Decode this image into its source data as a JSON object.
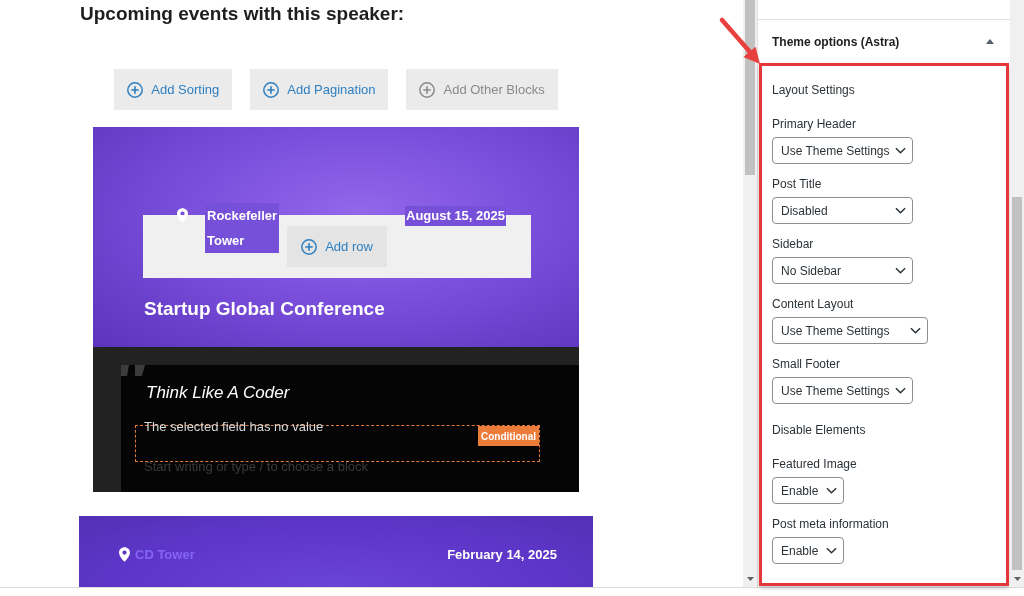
{
  "editor": {
    "heading": "Upcoming events with this speaker:",
    "block_buttons": [
      {
        "label": "Add Sorting",
        "disabled": false
      },
      {
        "label": "Add Pagination",
        "disabled": false
      },
      {
        "label": "Add Other Blocks",
        "disabled": true
      }
    ],
    "events": [
      {
        "kind": "editing",
        "location": "Rockefeller Tower",
        "date": "August 15, 2025",
        "add_row_button": "Add row",
        "title": "Startup Global Conference",
        "quote_block": {
          "quote": "Think Like A Coder",
          "field_text": "The selected field has no value",
          "badge": "Conditional",
          "placeholder": "Start writing or type / to choose a block"
        }
      },
      {
        "kind": "preview",
        "location": "CD Tower",
        "date": "February 14, 2025"
      }
    ]
  },
  "sidebar": {
    "panel": {
      "title": "Theme options (Astra)",
      "expanded": true,
      "sections": [
        {
          "heading": "Layout Settings",
          "fields": [
            {
              "label": "Primary Header",
              "value": "Use Theme Settings"
            },
            {
              "label": "Post Title",
              "value": "Disabled"
            },
            {
              "label": "Sidebar",
              "value": "No Sidebar"
            },
            {
              "label": "Content Layout",
              "value": "Use Theme Settings"
            },
            {
              "label": "Small Footer",
              "value": "Use Theme Settings"
            }
          ]
        },
        {
          "heading": "Disable Elements",
          "fields": [
            {
              "label": "Featured Image",
              "value": "Enable"
            },
            {
              "label": "Post meta information",
              "value": "Enable"
            }
          ]
        }
      ]
    }
  }
}
